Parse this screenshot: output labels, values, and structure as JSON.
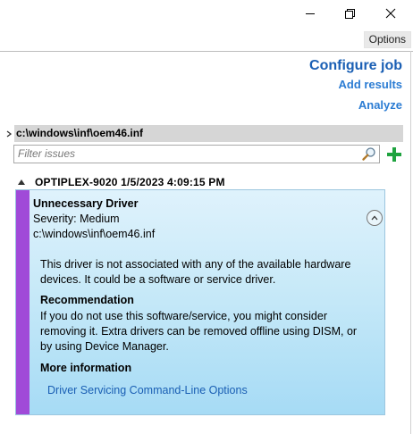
{
  "window": {
    "minimize_icon": "minimize-icon",
    "maximize_icon": "restore-icon",
    "close_icon": "close-icon"
  },
  "toolbar": {
    "options_label": "Options"
  },
  "actions": {
    "configure_job": "Configure job",
    "add_results": "Add results",
    "analyze": "Analyze"
  },
  "tree": {
    "path": "c:\\windows\\inf\\oem46.inf",
    "filter_placeholder": "Filter issues"
  },
  "group": {
    "title": "OPTIPLEX-9020 1/5/2023 4:09:15 PM"
  },
  "issue": {
    "title": "Unnecessary Driver",
    "severity": "Severity: Medium",
    "path": "c:\\windows\\inf\\oem46.inf",
    "description": "This driver is not associated with any of the available hardware devices. It could be a software or service driver.",
    "recommendation_heading": "Recommendation",
    "recommendation_text": "If you do not use this software/service, you might consider removing it. Extra drivers can be removed offline using DISM, or by using Device Manager.",
    "more_info_heading": "More information",
    "more_info_link": "Driver Servicing Command-Line Options",
    "severity_color": "#a04ad8"
  },
  "colors": {
    "accent": "#1a5fb4",
    "link": "#2b7cd3",
    "add_green": "#1fa33f"
  }
}
